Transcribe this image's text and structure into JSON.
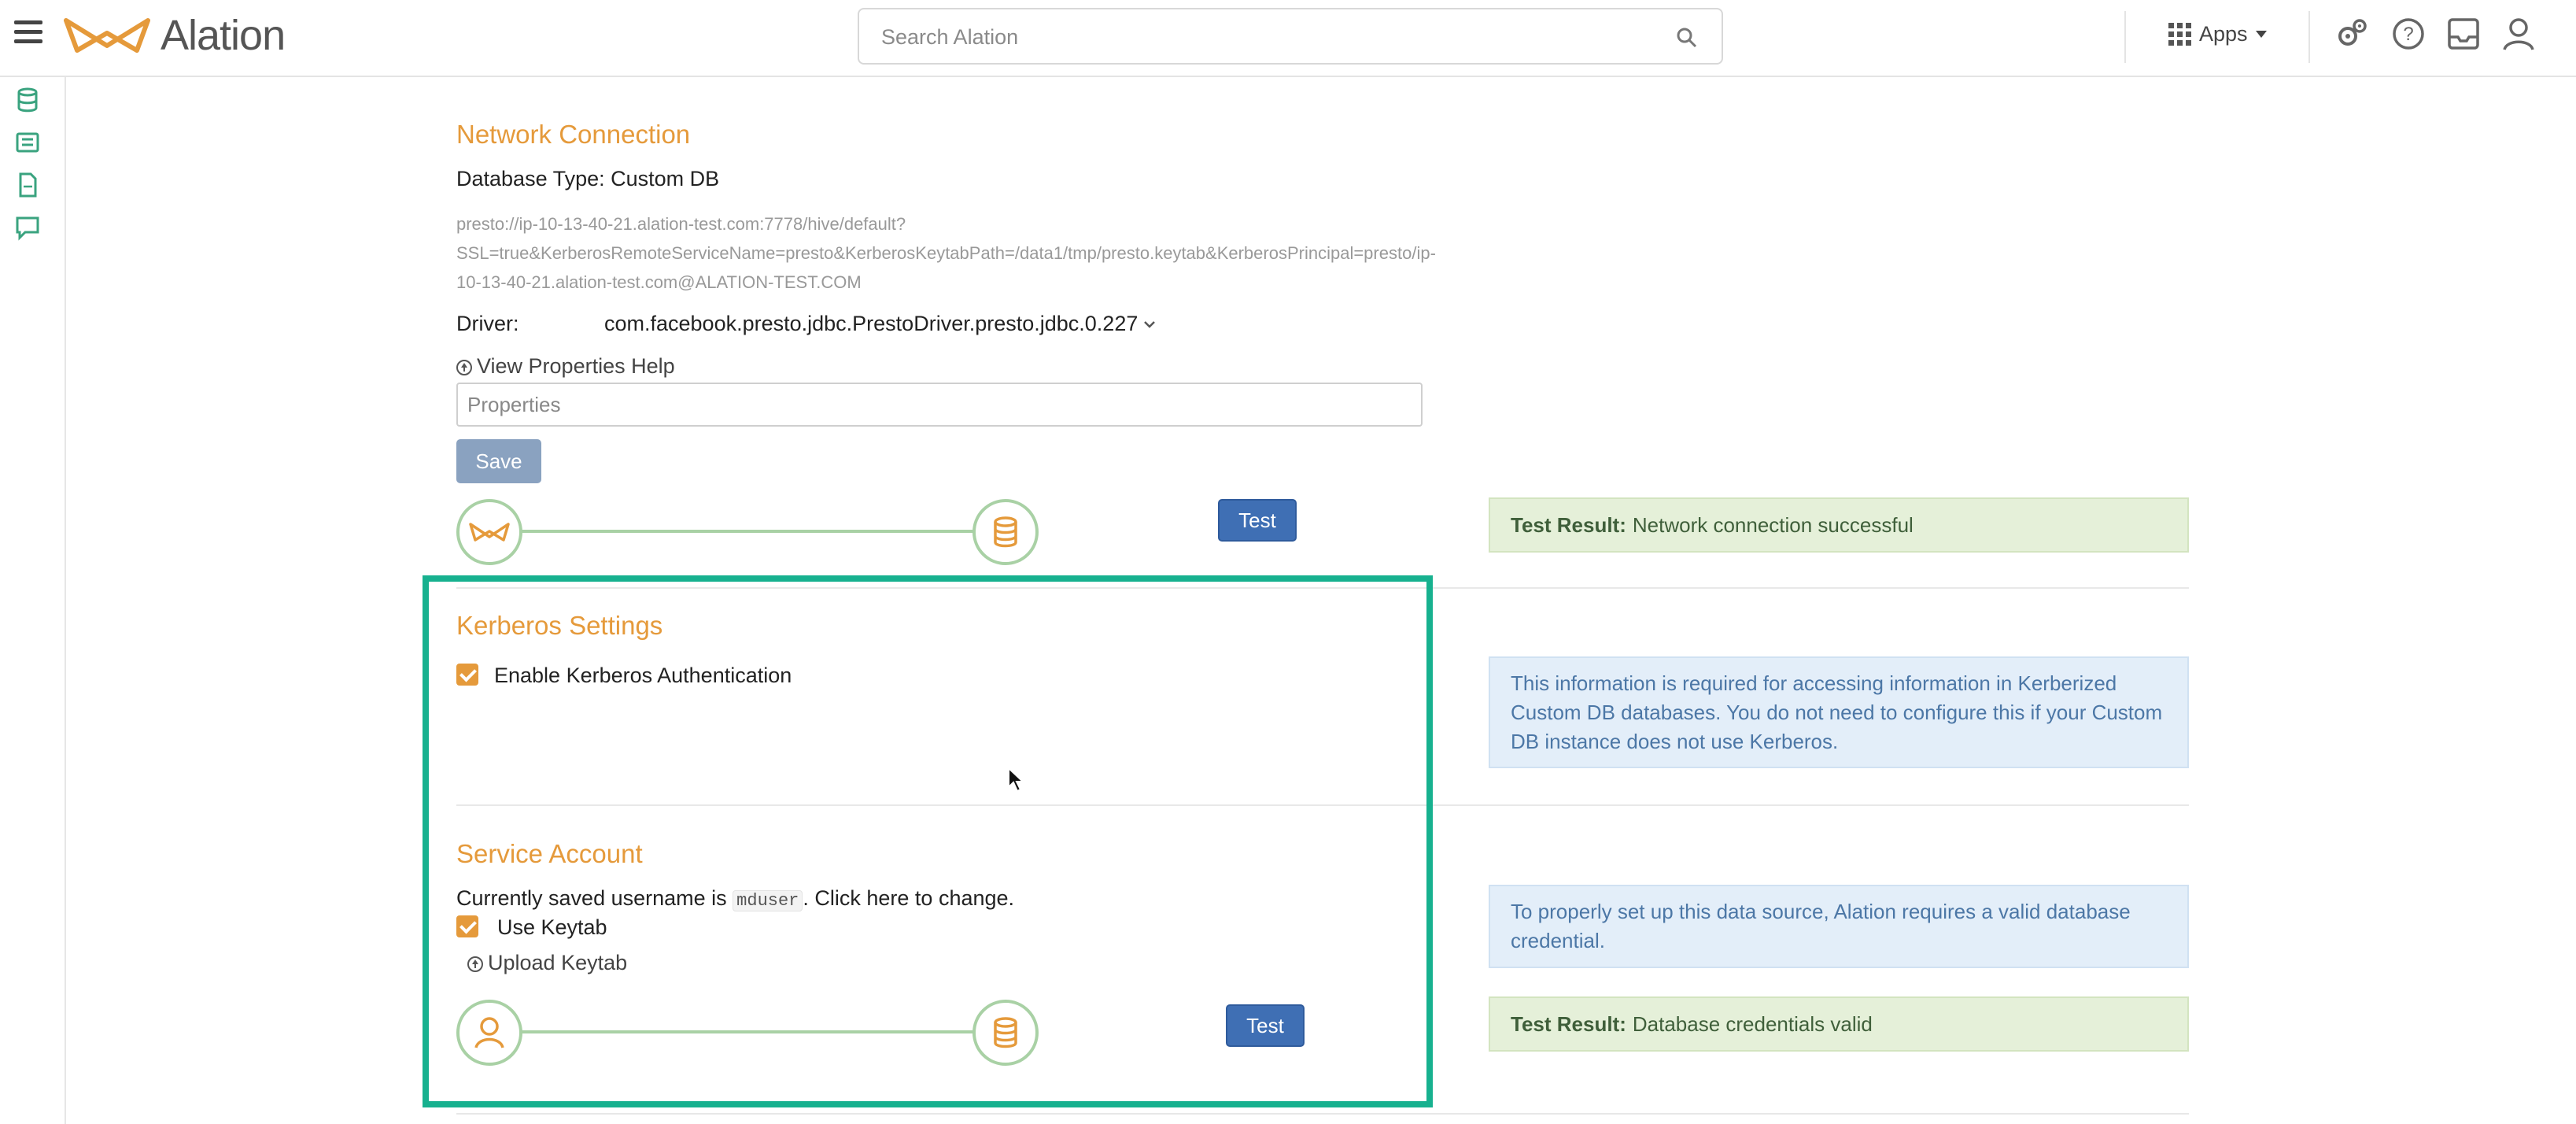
{
  "app": {
    "brand": "Alation",
    "brand_color": "#e59a3b",
    "search_placeholder": "Search Alation",
    "apps_label": "Apps"
  },
  "toolbar_icons": [
    "gears-icon",
    "help-icon",
    "inbox-icon",
    "user-icon"
  ],
  "sidebar_icons": [
    "database-icon",
    "catalog-icon",
    "document-icon",
    "conversation-icon"
  ],
  "network": {
    "title": "Network Connection",
    "db_type": "Database Type: Custom DB",
    "url_line1": "presto://ip-10-13-40-21.alation-test.com:7778/hive/default?",
    "url_line2": "SSL=true&KerberosRemoteServiceName=presto&KerberosKeytabPath=/data1/tmp/presto.keytab&KerberosPrincipal=presto/ip-",
    "url_line3": "10-13-40-21.alation-test.com@ALATION-TEST.COM",
    "driver_label": "Driver:",
    "driver_value": "com.facebook.presto.jdbc.PrestoDriver.presto.jdbc.0.227",
    "view_help": "View Properties Help",
    "properties_placeholder": "Properties",
    "save_label": "Save",
    "test_label": "Test",
    "result_label": "Test Result:",
    "result_text": "Network connection successful"
  },
  "kerberos": {
    "title": "Kerberos Settings",
    "enable_label": "Enable Kerberos Authentication",
    "enable_checked": true,
    "info": "This information is required for accessing information in Kerberized Custom DB databases. You do not need to configure this if your Custom DB instance does not use Kerberos."
  },
  "service": {
    "title": "Service Account",
    "saved_prefix": "Currently saved username is",
    "username": "mduser",
    "saved_suffix": ". Click here to change.",
    "keytab_label": "Use Keytab",
    "keytab_checked": true,
    "upload_label": "Upload Keytab",
    "test_label": "Test",
    "info": "To properly set up this data source, Alation requires a valid database credential.",
    "result_label": "Test Result:",
    "result_text": "Database credentials valid"
  },
  "colors": {
    "accent_orange": "#e59a3b",
    "highlight_teal": "#17b18f",
    "node_green": "#a9d1a5",
    "test_blue": "#3f6fb4"
  }
}
